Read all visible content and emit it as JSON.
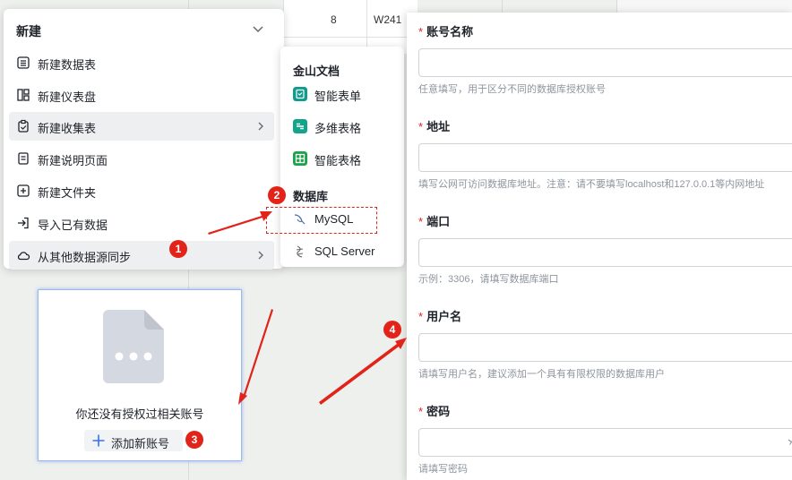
{
  "background": {
    "row_number": "8",
    "cell_code": "W241"
  },
  "menu": {
    "title": "新建",
    "items": [
      {
        "label": "新建数据表",
        "icon": "table-icon"
      },
      {
        "label": "新建仪表盘",
        "icon": "dashboard-icon"
      },
      {
        "label": "新建收集表",
        "icon": "form-icon"
      },
      {
        "label": "新建说明页面",
        "icon": "doc-icon"
      },
      {
        "label": "新建文件夹",
        "icon": "folder-plus-icon"
      },
      {
        "label": "导入已有数据",
        "icon": "import-icon"
      },
      {
        "label": "从其他数据源同步",
        "icon": "cloud-icon"
      }
    ]
  },
  "submenu": {
    "group1": "金山文档",
    "group1_items": [
      {
        "label": "智能表单",
        "color": "#0f9b8e"
      },
      {
        "label": "多维表格",
        "color": "#12a58c"
      },
      {
        "label": "智能表格",
        "color": "#1aa34a"
      }
    ],
    "group2": "数据库",
    "group2_items": [
      {
        "label": "MySQL",
        "icon": "mysql-dolphin-icon"
      },
      {
        "label": "SQL Server",
        "icon": "sqlserver-icon"
      }
    ]
  },
  "empty_state": {
    "message": "你还没有授权过相关账号",
    "add_label": "添加新账号"
  },
  "form": {
    "fields": [
      {
        "label": "账号名称",
        "hint": "任意填写，用于区分不同的数据库授权账号",
        "value": ""
      },
      {
        "label": "地址",
        "hint": "填写公网可访问数据库地址。注意：请不要填写localhost和127.0.0.1等内网地址",
        "value": ""
      },
      {
        "label": "端口",
        "hint": "示例：3306，请填写数据库端口",
        "value": ""
      },
      {
        "label": "用户名",
        "hint": "请填写用户名，建议添加一个具有有限权限的数据库用户",
        "value": ""
      },
      {
        "label": "密码",
        "hint": "请填写密码",
        "value": ""
      }
    ],
    "required_mark": "*"
  },
  "annotations": {
    "steps": [
      "1",
      "2",
      "3",
      "4"
    ],
    "color": "#e2231a"
  }
}
